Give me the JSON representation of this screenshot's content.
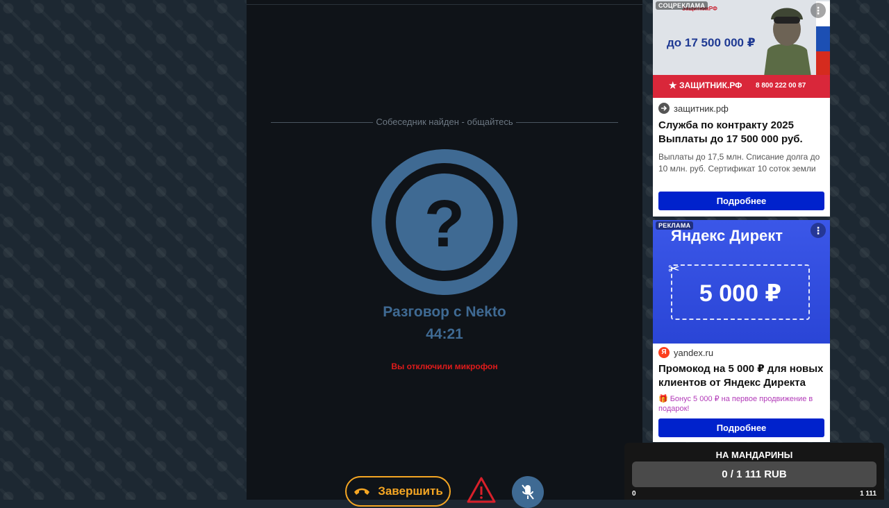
{
  "chat": {
    "status_text": "Собеседник найден - общайтесь",
    "avatar_symbol": "?",
    "conversation_title": "Разговор с Nekto",
    "timer": "44:21",
    "mic_warning": "Вы отключили микрофон",
    "end_button_label": "Завершить",
    "icons": {
      "end": "phone-hangup-icon",
      "report": "warning-triangle-icon",
      "mute": "microphone-off-icon"
    }
  },
  "ads": [
    {
      "label": "СОЦРЕКЛАМА",
      "banner_logo_text": "ЗащитникРФ",
      "banner_amount": "до 17 500 000 ₽",
      "banner_site": "ЗАЩИТНИК.РФ",
      "banner_phone": "8 800 222 00 87",
      "domain": "защитник.рф",
      "headline": "Служба по контракту 2025 Выплаты до 17 500 000 руб.",
      "description": "Выплаты до 17,5 млн. Списание долга до 10 млн. руб. Сертификат 10 соток земли",
      "cta": "Подробнее"
    },
    {
      "label": "РЕКЛАМА",
      "banner_brand": "Яндекс Директ",
      "banner_amount": "5 000 ₽",
      "domain": "yandex.ru",
      "headline": "Промокод на 5 000 ₽ для новых клиентов от Яндекс Директа",
      "bonus": "Бонус 5 000 ₽ на первое продвижение в подарок!",
      "cta": "Подробнее"
    }
  ],
  "donation": {
    "title": "НА МАНДАРИНЫ",
    "progress_text": "0 / 1 111 RUB",
    "progress_fraction": 0,
    "min_label": "0",
    "max_label": "1 111"
  },
  "colors": {
    "accent_blue": "#3f6a93",
    "end_orange": "#f5a623",
    "warning_red": "#e01b1b",
    "cta_blue": "#0022cc"
  }
}
